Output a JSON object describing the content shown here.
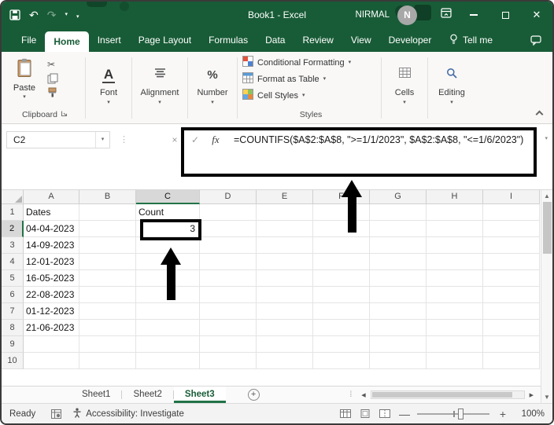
{
  "window": {
    "title": "Book1 - Excel",
    "user_name": "NIRMAL",
    "avatar_initial": "N"
  },
  "ribbon_tabs": [
    "File",
    "Home",
    "Insert",
    "Page Layout",
    "Formulas",
    "Data",
    "Review",
    "View",
    "Developer"
  ],
  "tell_me_label": "Tell me",
  "ribbon": {
    "paste_label": "Paste",
    "clipboard_label": "Clipboard",
    "font_label": "Font",
    "alignment_label": "Alignment",
    "number_label": "Number",
    "styles_items": [
      "Conditional Formatting",
      "Format as Table",
      "Cell Styles"
    ],
    "styles_label": "Styles",
    "cells_label": "Cells",
    "editing_label": "Editing"
  },
  "formula_bar": {
    "name_box": "C2",
    "cancel": "×",
    "enter": "✓",
    "fx": "fx",
    "formula": "=COUNTIFS($A$2:$A$8, \">=1/1/2023\", $A$2:$A$8, \"<=1/6/2023\")"
  },
  "grid": {
    "columns": [
      "A",
      "B",
      "C",
      "D",
      "E",
      "F",
      "G",
      "H",
      "I"
    ],
    "selected_column": "C",
    "selected_row": "2",
    "rows": [
      {
        "n": "1",
        "A": "Dates",
        "C": "Count"
      },
      {
        "n": "2",
        "A": "04-04-2023",
        "C": "3"
      },
      {
        "n": "3",
        "A": "14-09-2023"
      },
      {
        "n": "4",
        "A": "12-01-2023"
      },
      {
        "n": "5",
        "A": "16-05-2023"
      },
      {
        "n": "6",
        "A": "22-08-2023"
      },
      {
        "n": "7",
        "A": "01-12-2023"
      },
      {
        "n": "8",
        "A": "21-06-2023"
      },
      {
        "n": "9"
      },
      {
        "n": "10"
      }
    ]
  },
  "sheets": {
    "tabs": [
      "Sheet1",
      "Sheet2",
      "Sheet3"
    ],
    "active": "Sheet3"
  },
  "status_bar": {
    "mode": "Ready",
    "accessibility": "Accessibility: Investigate",
    "zoom_level": "100%"
  },
  "colors": {
    "excel_green": "#185C37",
    "accent_green": "#217346",
    "annotation_black": "#000000"
  }
}
